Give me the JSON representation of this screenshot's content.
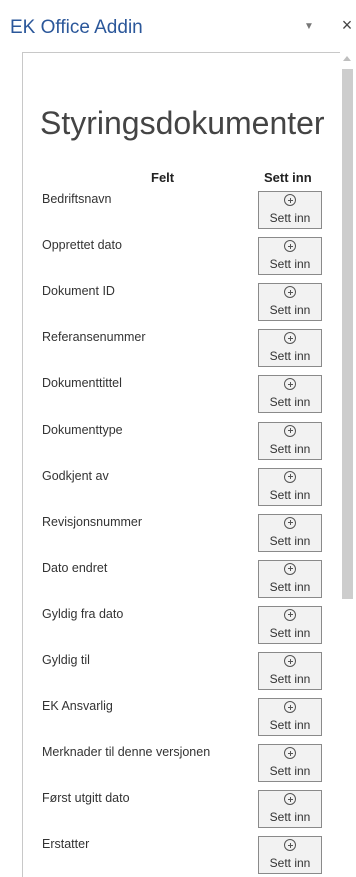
{
  "pane": {
    "title": "EK Office Addin",
    "menu_glyph": "▼",
    "close_glyph": "×"
  },
  "main": {
    "heading": "Styringsdokumenter",
    "columns": {
      "field": "Felt",
      "insert": "Sett inn"
    },
    "fields": [
      {
        "label": "Bedriftsnavn",
        "button": "Sett inn"
      },
      {
        "label": "Opprettet dato",
        "button": "Sett inn"
      },
      {
        "label": "Dokument ID",
        "button": "Sett inn"
      },
      {
        "label": "Referansenummer",
        "button": "Sett inn"
      },
      {
        "label": "Dokumenttittel",
        "button": "Sett inn"
      },
      {
        "label": "Dokumenttype",
        "button": "Sett inn"
      },
      {
        "label": "Godkjent av",
        "button": "Sett inn"
      },
      {
        "label": "Revisjonsnummer",
        "button": "Sett inn"
      },
      {
        "label": "Dato endret",
        "button": "Sett inn"
      },
      {
        "label": "Gyldig fra dato",
        "button": "Sett inn"
      },
      {
        "label": "Gyldig til",
        "button": "Sett inn"
      },
      {
        "label": "EK Ansvarlig",
        "button": "Sett inn"
      },
      {
        "label": "Merknader til denne versjonen",
        "button": "Sett inn"
      },
      {
        "label": "Først utgitt dato",
        "button": "Sett inn"
      },
      {
        "label": "Erstatter",
        "button": "Sett inn"
      }
    ]
  },
  "icons": {
    "insert": "plus-circle-icon",
    "menu": "chevron-down-icon",
    "close": "close-icon",
    "scroll_up": "scroll-up-arrow-icon"
  },
  "colors": {
    "title": "#2b579a",
    "button_bg": "#f2f2f2",
    "button_border": "#8a8a8a",
    "scroll_thumb": "#cdcdcd"
  }
}
